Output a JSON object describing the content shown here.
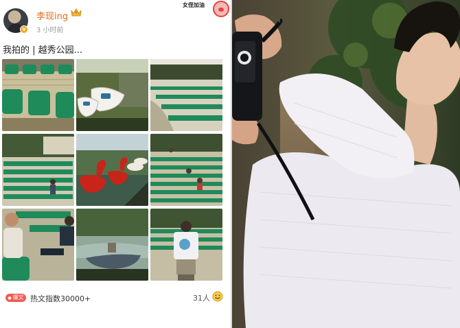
{
  "post": {
    "username": "李现ing",
    "timestamp": "3 小时前",
    "verified_badge": "v",
    "sticker_text": "女侄加油",
    "caption": "我拍的 | 越秀公园...",
    "heat_badge": "爆文",
    "heat_text": "热文指数30000+",
    "like_count": "31人"
  },
  "icons": [
    "avatar",
    "crown-icon",
    "cat-sticker-icon",
    "hot-badge-icon",
    "like-reaction-icon",
    "camera-icon"
  ],
  "colors": {
    "username": "#e86a1d",
    "stadium_green": "#1f8a5a",
    "heat_badge": "#f25a52",
    "swan_red": "#c8241a"
  }
}
